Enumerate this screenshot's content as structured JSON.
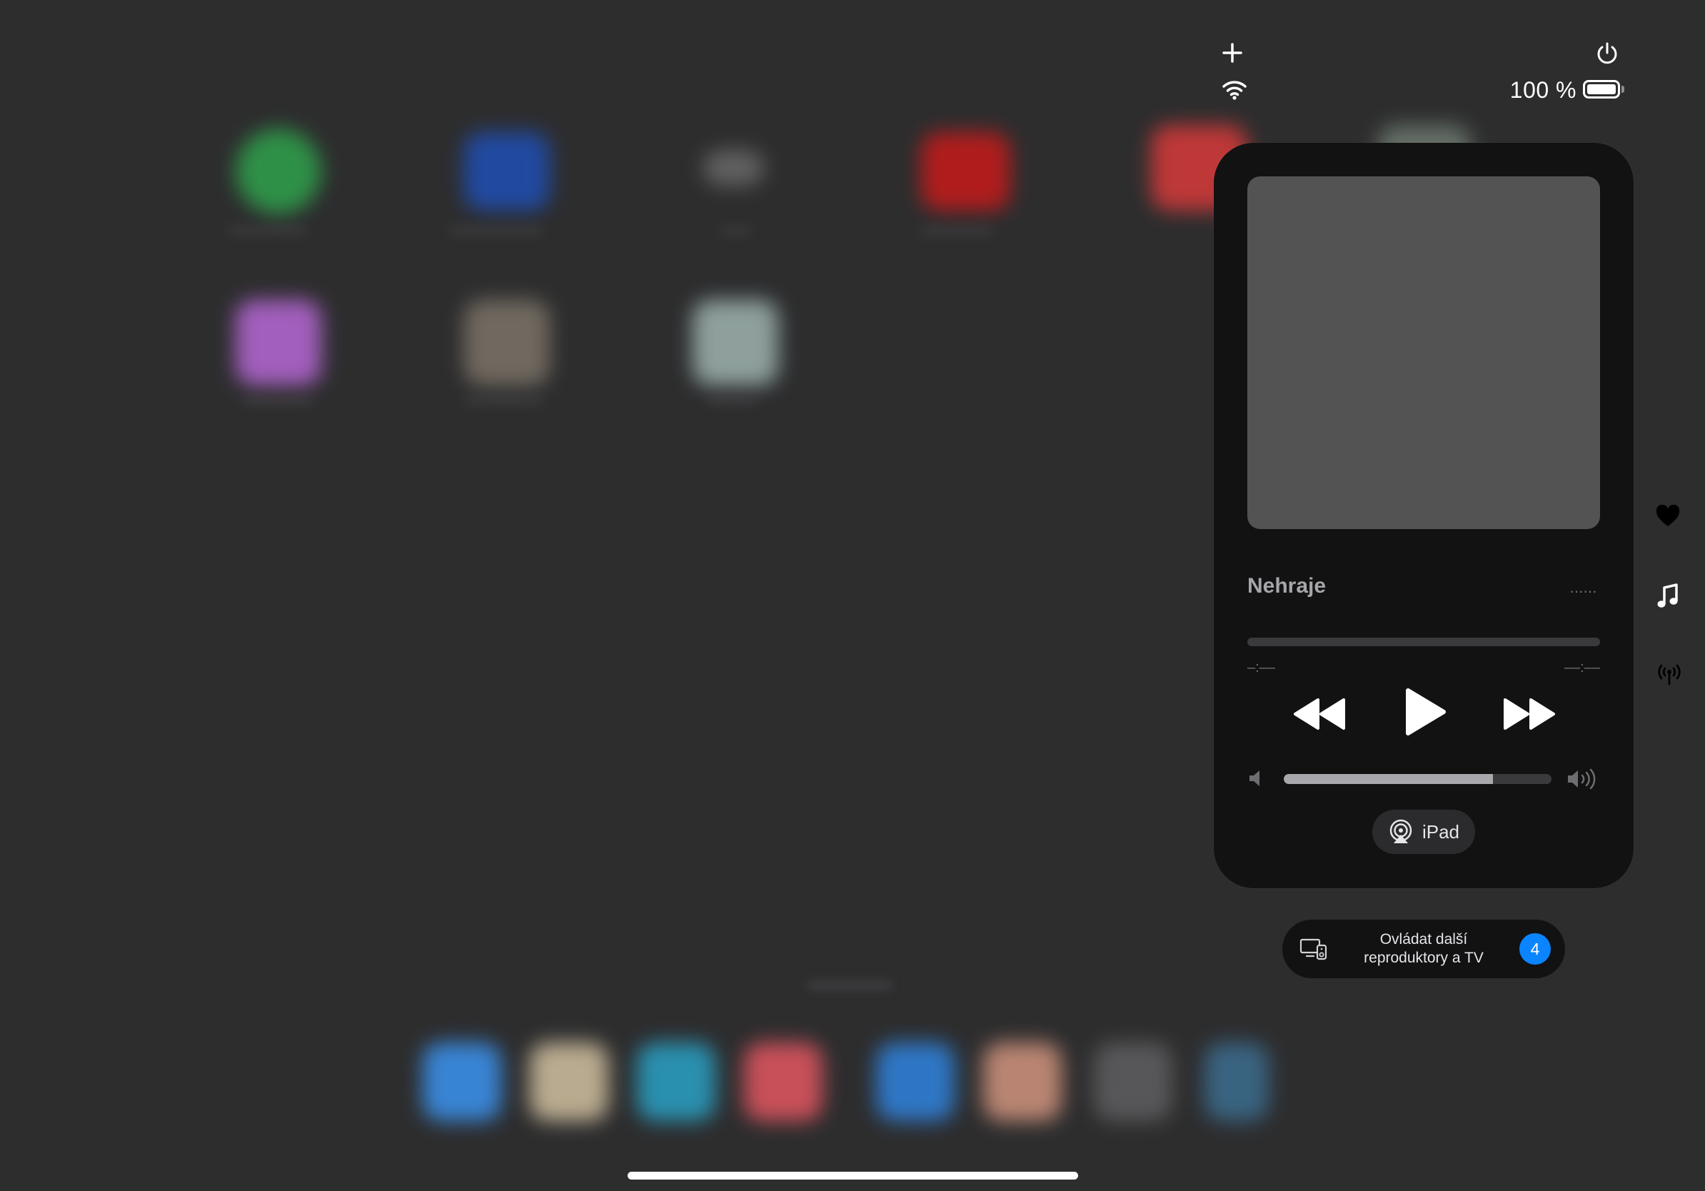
{
  "status": {
    "battery_text": "100 %",
    "battery_level": 1.0
  },
  "now_playing": {
    "title": "Nehraje",
    "more_label": "······",
    "time_elapsed": "–:––",
    "time_remaining": "––:––",
    "progress": 0,
    "volume": 0.78,
    "output_device": "iPad"
  },
  "other_speakers": {
    "label": "Ovládat další\nreproduktory a TV",
    "count": "4"
  },
  "icons": {
    "add": "plus-icon",
    "wifi": "wifi-icon",
    "power": "power-icon",
    "favorites": "heart-icon",
    "music": "music-note-icon",
    "connectivity": "antenna-icon",
    "airplay": "airplay-icon",
    "devices": "display-speaker-icon"
  },
  "colors": {
    "accent": "#0a84ff",
    "card": "#121213",
    "artwork": "#535354"
  }
}
